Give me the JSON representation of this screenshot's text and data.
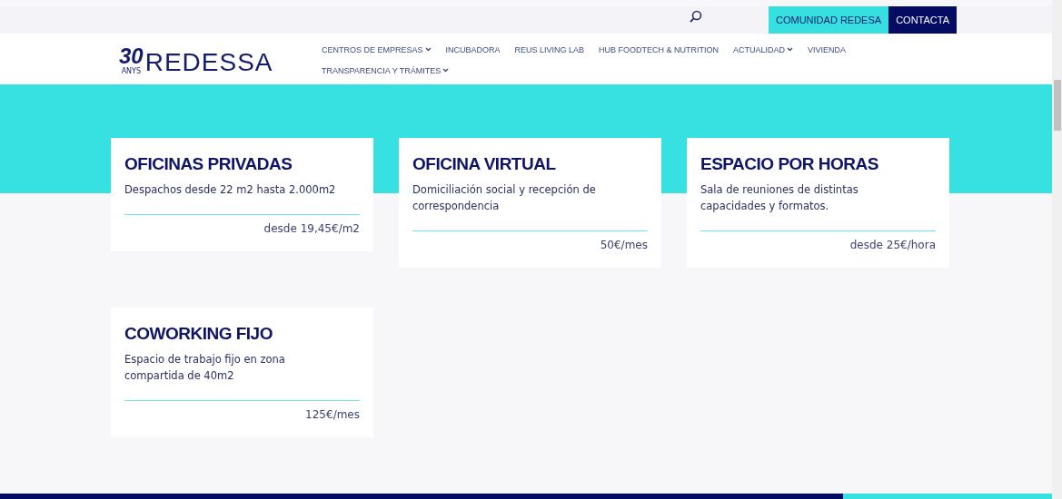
{
  "topbar": {
    "buttons": [
      {
        "label": "COMUNIDAD REDESA",
        "kind": "community"
      },
      {
        "label": "CONTACTA",
        "kind": "contact"
      }
    ]
  },
  "logo": {
    "number": "30",
    "caption": "ANYS",
    "name": "REDESSA"
  },
  "nav": [
    {
      "label": "CENTROS DE EMPRESAS",
      "has_dropdown": true
    },
    {
      "label": "INCUBADORA",
      "has_dropdown": false
    },
    {
      "label": "REUS LIVING LAB",
      "has_dropdown": false
    },
    {
      "label": "HUB FOODTECH & NUTRITION",
      "has_dropdown": false
    },
    {
      "label": "ACTUALIDAD",
      "has_dropdown": true
    },
    {
      "label": "VIVIENDA",
      "has_dropdown": false
    },
    {
      "label": "TRANSPARENCIA Y TRÁMITES",
      "has_dropdown": true
    }
  ],
  "cards": [
    {
      "title": "OFICINAS PRIVADAS",
      "description": "Despachos desde 22 m2 hasta 2.000m2",
      "price": "desde 19,45€/m2"
    },
    {
      "title": "OFICINA VIRTUAL",
      "description": "Domiciliación social y recepción de correspondencia",
      "price": "50€/mes"
    },
    {
      "title": "ESPACIO POR HORAS",
      "description": "Sala de reuniones de distintas capacidades y formatos.",
      "price": "desde 25€/hora"
    },
    {
      "title": "COWORKING FIJO",
      "description": "Espacio de trabajo fijo en zona compartida de 40m2",
      "price": "125€/mes"
    }
  ]
}
